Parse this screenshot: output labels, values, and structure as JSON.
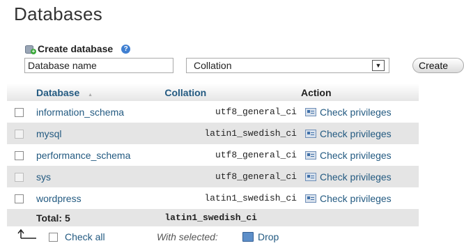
{
  "page": {
    "title": "Databases"
  },
  "create": {
    "heading": "Create database",
    "name_placeholder": "Database name",
    "collation_value": "Collation",
    "button_label": "Create",
    "icons": {
      "db": "database-add-icon",
      "help": "help-icon"
    }
  },
  "table": {
    "headers": {
      "database": "Database",
      "collation": "Collation",
      "action": "Action"
    },
    "sort_indicator": "▲",
    "rows": [
      {
        "name": "information_schema",
        "collation": "utf8_general_ci",
        "action": "Check privileges"
      },
      {
        "name": "mysql",
        "collation": "latin1_swedish_ci",
        "action": "Check privileges"
      },
      {
        "name": "performance_schema",
        "collation": "utf8_general_ci",
        "action": "Check privileges"
      },
      {
        "name": "sys",
        "collation": "utf8_general_ci",
        "action": "Check privileges"
      },
      {
        "name": "wordpress",
        "collation": "latin1_swedish_ci",
        "action": "Check privileges"
      }
    ],
    "total": {
      "label": "Total: 5",
      "collation": "latin1_swedish_ci"
    }
  },
  "footer": {
    "check_all": "Check all",
    "with_selected": "With selected:",
    "drop": "Drop"
  }
}
